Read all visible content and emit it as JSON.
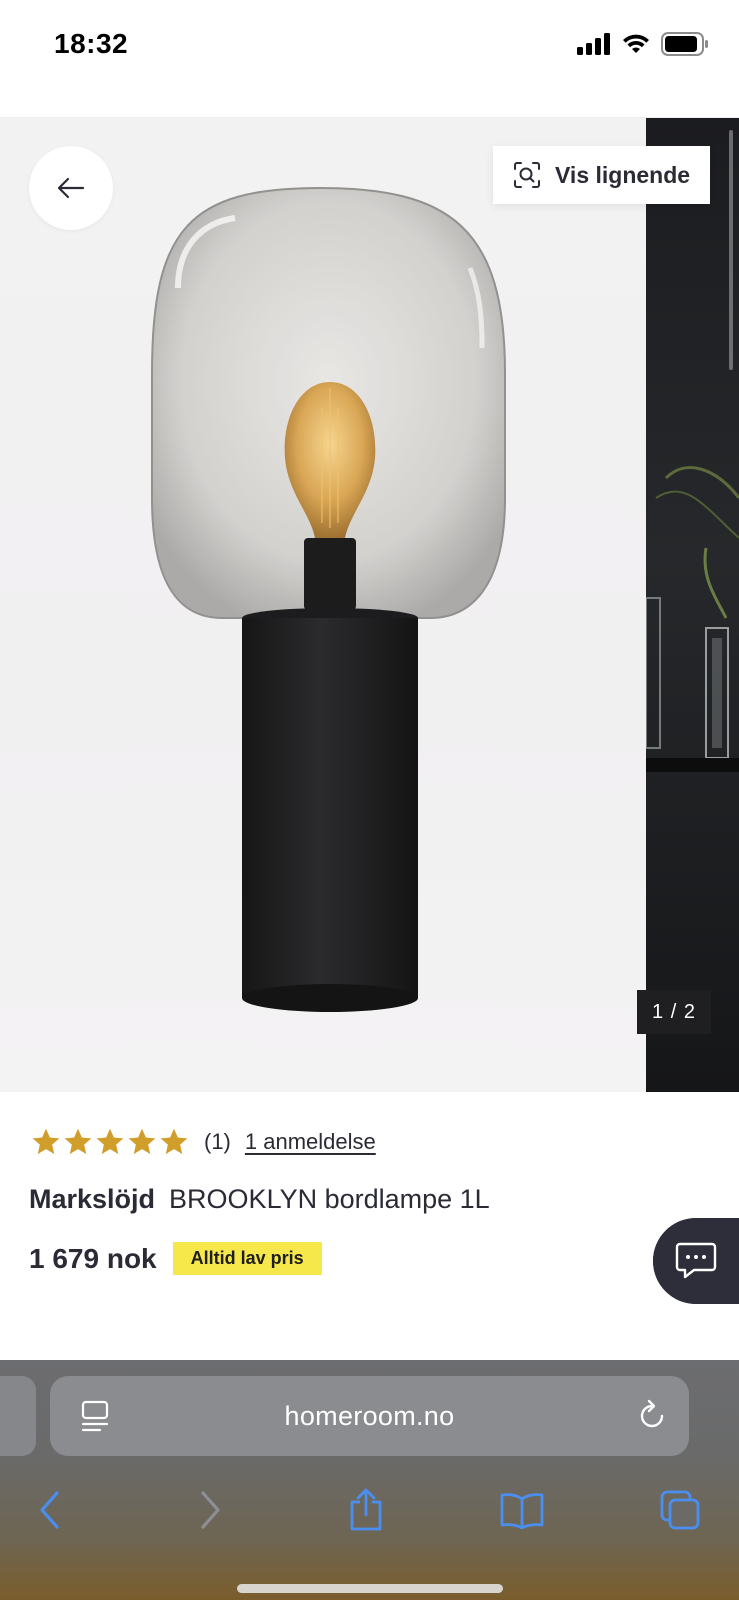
{
  "status": {
    "time": "18:32"
  },
  "gallery": {
    "similar_label": "Vis lignende",
    "counter": "1 / 2"
  },
  "product": {
    "rating": 5,
    "rating_count": "(1)",
    "review_link": "1 anmeldelse",
    "brand": "Markslöjd",
    "name": "BROOKLYN bordlampe 1L",
    "price": "1 679 nok",
    "badge": "Alltid lav pris"
  },
  "browser": {
    "url": "homeroom.no"
  },
  "colors": {
    "text": "#2b2b36",
    "star": "#d19e2b",
    "badge": "#f6e84a",
    "chat": "#2e2e3a",
    "link_blue": "#4a8ff0"
  }
}
